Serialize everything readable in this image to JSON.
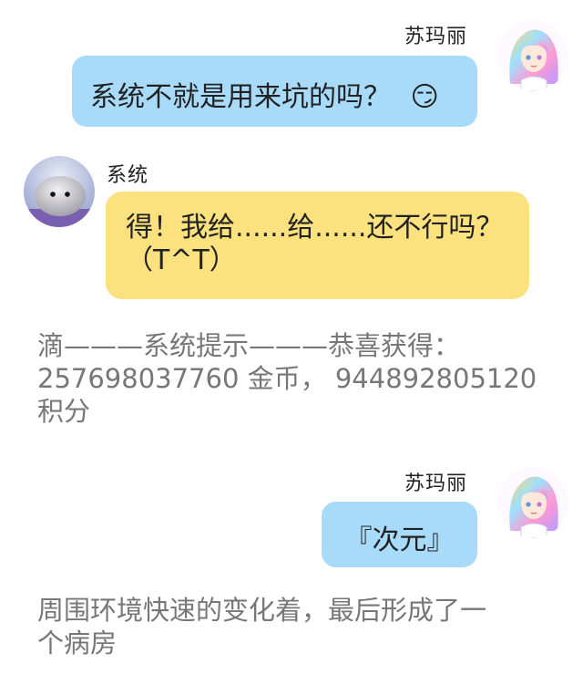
{
  "messages": [
    {
      "sender": "苏玛丽",
      "text": "系统不就是用来坑的吗？",
      "emoji": "😏"
    },
    {
      "sender": "系统",
      "text_line1": "得！我给......给......还不行吗？",
      "text_line2": "（T^T）"
    },
    {
      "sender": "苏玛丽",
      "text": "『次元』"
    }
  ],
  "narration": [
    {
      "line1": "滴———系统提示———恭喜获得：",
      "line2": "257698037760 金币， 944892805120",
      "line3": "积分"
    },
    {
      "line1": "周围环境快速的变化着，最后形成了一",
      "line2": "个病房"
    }
  ],
  "colors": {
    "blue_bubble": "#a8dafa",
    "yellow_bubble": "#fbe27f",
    "narration_text": "#777777"
  },
  "icons": {
    "avatar_sumali": "anime-girl-avatar",
    "avatar_system": "fluffy-creature-avatar"
  }
}
